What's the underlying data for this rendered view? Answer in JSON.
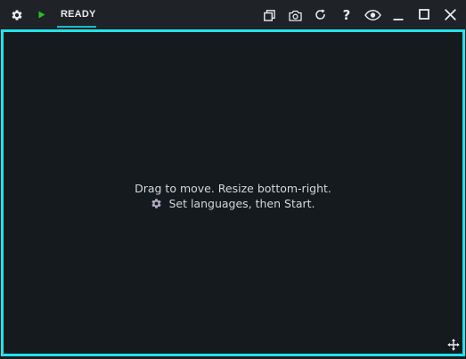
{
  "titlebar": {
    "status": "READY",
    "icons": {
      "settings": "gear-icon",
      "start": "play-icon",
      "copy": "copy-icon",
      "screenshot": "camera-icon",
      "refresh": "refresh-icon",
      "help": "help-icon",
      "visibility": "eye-icon",
      "minimize": "minimize-icon",
      "maximize": "maximize-icon",
      "close": "close-icon"
    },
    "help_glyph": "?"
  },
  "content": {
    "line1": "Drag to move. Resize bottom-right.",
    "line2": "Set languages, then Start."
  },
  "colors": {
    "accent": "#22e3ea",
    "play": "#22c02a",
    "background": "#151a1f",
    "titlebar": "#1f2226",
    "text": "#d3d7db"
  }
}
